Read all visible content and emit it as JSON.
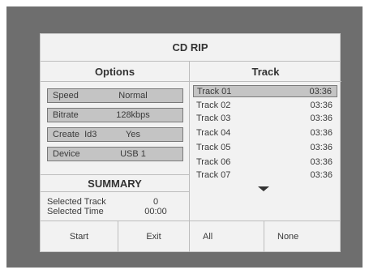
{
  "title": "CD RIP",
  "options": {
    "header": "Options",
    "items": [
      {
        "label": "Speed",
        "value": "Normal"
      },
      {
        "label": "Bitrate",
        "value": "128kbps"
      },
      {
        "label": "Create  Id3",
        "value": "Yes"
      },
      {
        "label": "Device",
        "value": "USB 1"
      }
    ]
  },
  "summary": {
    "header": "SUMMARY",
    "selected_track_label": "Selected Track",
    "selected_track_value": "0",
    "selected_time_label": "Selected Time",
    "selected_time_value": "00:00"
  },
  "tracks": {
    "header": "Track",
    "items": [
      {
        "name": "Track 01",
        "time": "03:36"
      },
      {
        "name": "Track 02",
        "time": "03:36"
      },
      {
        "name": "Track 03",
        "time": "03:36"
      },
      {
        "name": "Track 04",
        "time": "03:36"
      },
      {
        "name": "Track 05",
        "time": "03:36"
      },
      {
        "name": "Track 06",
        "time": "03:36"
      },
      {
        "name": "Track 07",
        "time": "03:36"
      }
    ],
    "selected_index": 0,
    "more_indicator_icon": "triangle-down-icon"
  },
  "buttons": {
    "start": "Start",
    "exit": "Exit",
    "all": "All",
    "none": "None"
  }
}
